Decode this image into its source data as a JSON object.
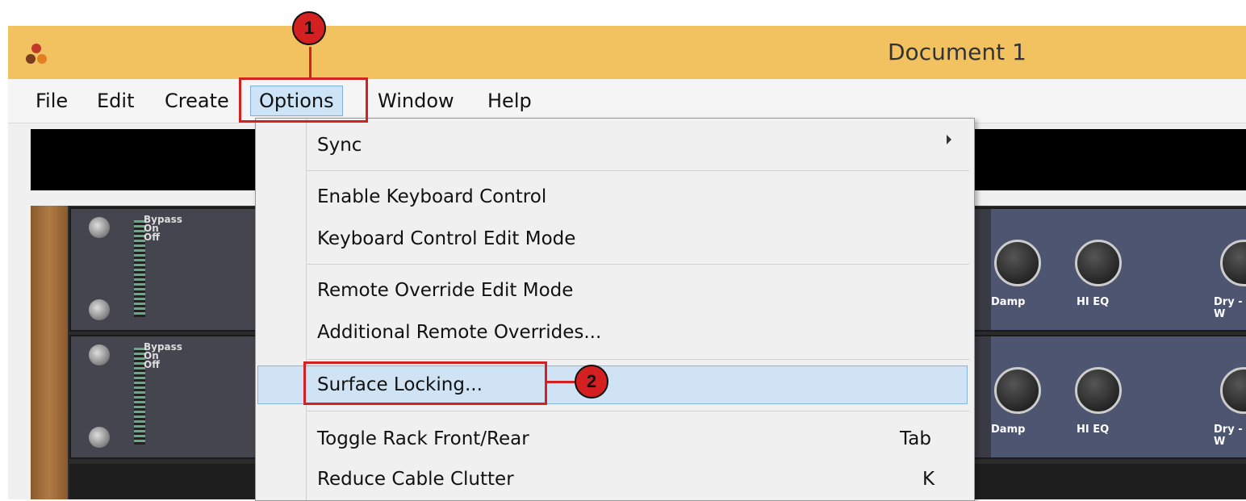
{
  "window": {
    "title": "Document 1",
    "icon": "propellerhead-logo-icon"
  },
  "menubar": {
    "items": [
      {
        "label": "File"
      },
      {
        "label": "Edit"
      },
      {
        "label": "Create"
      },
      {
        "label": "Options"
      },
      {
        "label": "Window"
      },
      {
        "label": "Help"
      }
    ]
  },
  "options_menu": {
    "items": [
      {
        "label": "Sync",
        "shortcut": ""
      },
      {
        "label": "Enable Keyboard Control",
        "shortcut": ""
      },
      {
        "label": "Keyboard Control Edit Mode",
        "shortcut": ""
      },
      {
        "label": "Remote Override Edit Mode",
        "shortcut": ""
      },
      {
        "label": "Additional Remote Overrides...",
        "shortcut": ""
      },
      {
        "label": "Surface Locking...",
        "shortcut": ""
      },
      {
        "label": "Toggle Rack Front/Rear",
        "shortcut": "Tab"
      },
      {
        "label": "Reduce Cable Clutter",
        "shortcut": "K"
      }
    ]
  },
  "devices": [
    {
      "bypass": "Bypass",
      "on": "On",
      "off": "Off",
      "knob1": "Damp",
      "knob2": "HI EQ",
      "knob3": "Dry - W"
    },
    {
      "bypass": "Bypass",
      "on": "On",
      "off": "Off",
      "knob1": "Damp",
      "knob2": "HI EQ",
      "knob3": "Dry - W"
    }
  ],
  "annotations": {
    "step1": "1",
    "step2": "2"
  },
  "colors": {
    "titlebar": "#f2c160",
    "annotation": "#d42020",
    "highlight": "#cfe3f5"
  }
}
